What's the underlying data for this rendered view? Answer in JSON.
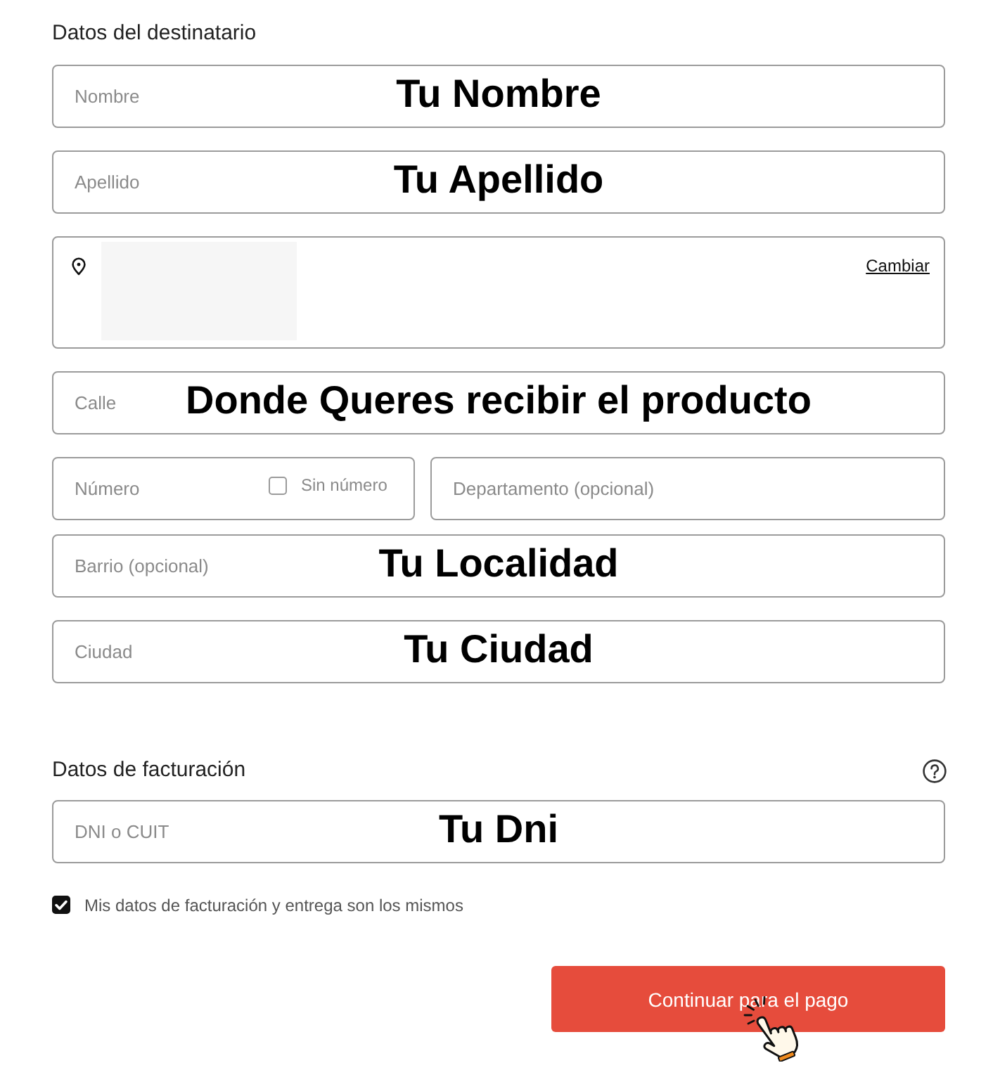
{
  "recipient": {
    "title": "Datos del destinatario",
    "fields": [
      {
        "kind": "text",
        "placeholder": "Nombre",
        "annotation": "Tu Nombre"
      },
      {
        "kind": "text",
        "placeholder": "Apellido",
        "annotation": "Tu Apellido"
      },
      {
        "kind": "address",
        "link": "Cambiar"
      },
      {
        "kind": "text",
        "placeholder": "Calle",
        "annotation": "Donde Queres recibir el producto"
      },
      {
        "kind": "pair",
        "fields": [
          {
            "placeholder": "Número",
            "checkbox": {
              "label": "Sin número",
              "checked": false
            }
          },
          {
            "placeholder": "Departamento (opcional)"
          }
        ]
      },
      {
        "kind": "text",
        "placeholder": "Barrio (opcional)",
        "annotation": "Tu Localidad"
      },
      {
        "kind": "text",
        "placeholder": "Ciudad",
        "annotation": "Tu Ciudad"
      }
    ]
  },
  "billing": {
    "title": "Datos de facturación",
    "fields": [
      {
        "kind": "text",
        "placeholder": "DNI o CUIT",
        "annotation": "Tu Dni"
      }
    ],
    "same_data": {
      "label": "Mis datos de facturación y entrega son los mismos",
      "checked": true
    }
  },
  "submit": {
    "label": "Continuar para el pago"
  }
}
